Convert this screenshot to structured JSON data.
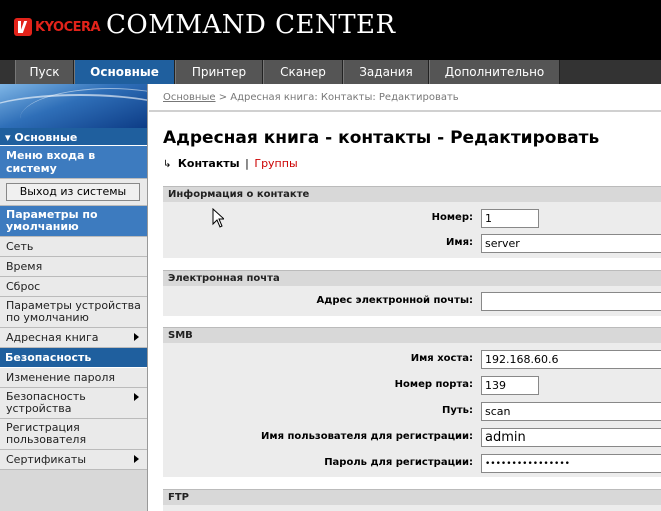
{
  "header": {
    "logo": "KYOCERA",
    "title": "COMMAND CENTER"
  },
  "nav": {
    "tabs": [
      {
        "label": "Пуск"
      },
      {
        "label": "Основные"
      },
      {
        "label": "Принтер"
      },
      {
        "label": "Сканер"
      },
      {
        "label": "Задания"
      },
      {
        "label": "Дополнительно"
      }
    ]
  },
  "sidebar": {
    "section_basic": "▾ Основные",
    "login_menu": "Меню входа в систему",
    "logout_button": "Выход из системы",
    "defaults_header": "Параметры по умолчанию",
    "items": [
      "Сеть",
      "Время",
      "Сброс",
      "Параметры устройства по умолчанию",
      "Адресная книга"
    ],
    "security_header": "Безопасность",
    "security_items": [
      "Изменение пароля",
      "Безопасность устройства",
      "Регистрация пользователя",
      "Сертификаты"
    ]
  },
  "main": {
    "breadcrumb_link": "Основные",
    "breadcrumb_rest": "Адресная книга: Контакты: Редактировать",
    "title": "Адресная книга - контакты - Редактировать",
    "subnav": {
      "current": "Контакты",
      "separator": "|",
      "link": "Группы"
    },
    "contact_info": {
      "header": "Информация о контакте",
      "number_label": "Номер:",
      "number_value": "1",
      "name_label": "Имя:",
      "name_value": "server"
    },
    "email": {
      "header": "Электронная почта",
      "address_label": "Адрес электронной почты:",
      "address_value": ""
    },
    "smb": {
      "header": "SMB",
      "host_label": "Имя хоста:",
      "host_value": "192.168.60.6",
      "port_label": "Номер порта:",
      "port_value": "139",
      "path_label": "Путь:",
      "path_value": "scan",
      "user_label": "Имя пользователя для регистрации:",
      "user_value": "admin",
      "password_label": "Пароль для регистрации:",
      "password_value": "••••••••••••••••"
    },
    "ftp": {
      "header": "FTP"
    }
  },
  "colors": {
    "accent": "#1f5f9e",
    "brand_red": "#e2231a",
    "header_bg": "#000000"
  },
  "icons": {
    "logo": "kyocera-logo",
    "subnav_marker": "arrow-return-icon",
    "submenu": "chevron-right-icon"
  }
}
